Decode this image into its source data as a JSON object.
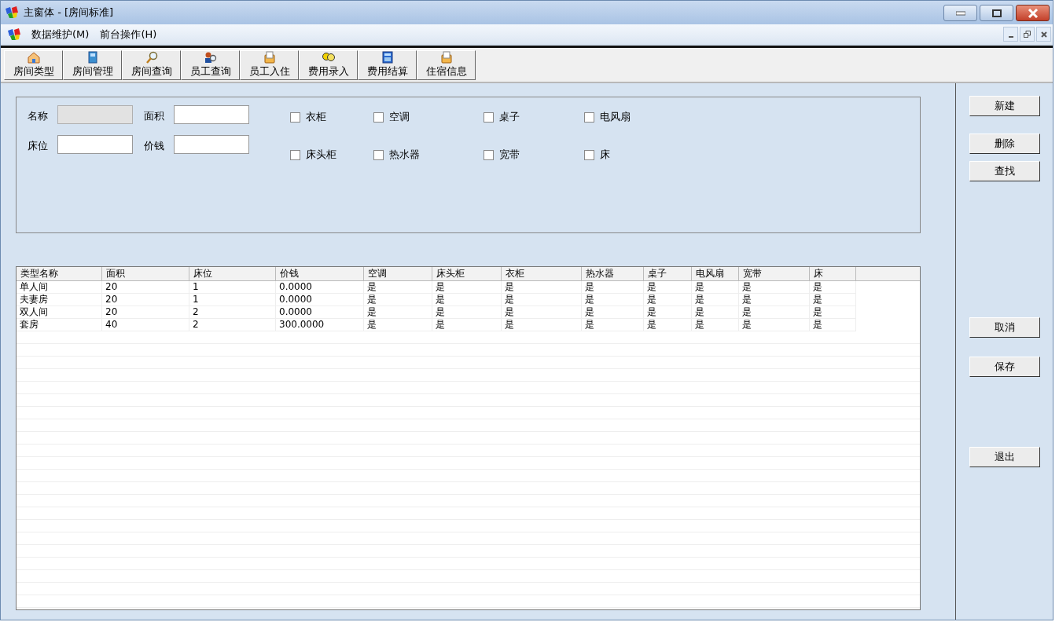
{
  "window": {
    "title": "主窗体 - [房间标准]"
  },
  "menu": [
    "数据维护(M)",
    "前台操作(H)"
  ],
  "toolbar": [
    "房间类型",
    "房间管理",
    "房间查询",
    "员工查询",
    "员工入住",
    "费用录入",
    "费用结算",
    "住宿信息"
  ],
  "form": {
    "fields": [
      {
        "label": "名称",
        "disabled": true
      },
      {
        "label": "面积",
        "disabled": false
      },
      {
        "label": "床位",
        "disabled": false
      },
      {
        "label": "价钱",
        "disabled": false
      }
    ],
    "checkboxes": [
      {
        "label": "衣柜",
        "checked": false
      },
      {
        "label": "空调",
        "checked": false
      },
      {
        "label": "桌子",
        "checked": false
      },
      {
        "label": "电风扇",
        "checked": false
      },
      {
        "label": "床头柜",
        "checked": false
      },
      {
        "label": "热水器",
        "checked": false
      },
      {
        "label": "宽带",
        "checked": false
      },
      {
        "label": "床",
        "checked": false
      }
    ]
  },
  "table": {
    "columns": [
      "类型名称",
      "面积",
      "床位",
      "价钱",
      "空调",
      "床头柜",
      "衣柜",
      "热水器",
      "桌子",
      "电风扇",
      "宽带",
      "床"
    ],
    "rows": [
      [
        "单人间",
        "20",
        "1",
        "0.0000",
        "是",
        "是",
        "是",
        "是",
        "是",
        "是",
        "是",
        "是"
      ],
      [
        "夫妻房",
        "20",
        "1",
        "0.0000",
        "是",
        "是",
        "是",
        "是",
        "是",
        "是",
        "是",
        "是"
      ],
      [
        "双人间",
        "20",
        "2",
        "0.0000",
        "是",
        "是",
        "是",
        "是",
        "是",
        "是",
        "是",
        "是"
      ],
      [
        "套房",
        "40",
        "2",
        "300.0000",
        "是",
        "是",
        "是",
        "是",
        "是",
        "是",
        "是",
        "是"
      ]
    ]
  },
  "buttons": [
    "新建",
    "删除",
    "查找",
    "取消",
    "保存",
    "退出"
  ]
}
